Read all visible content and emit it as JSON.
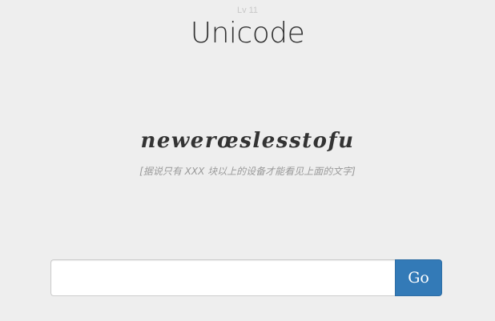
{
  "header": {
    "level": "Lv 11",
    "title": "Unicode"
  },
  "puzzle": {
    "text": "newerœslesstofu",
    "caption": "[据说只有 XXX 块以上的设备才能看见上面的文字]"
  },
  "answer_form": {
    "input_value": "",
    "input_placeholder": "",
    "submit_label": "Go"
  },
  "colors": {
    "background": "#eeeeee",
    "button": "#337ab7",
    "text": "#333333"
  }
}
